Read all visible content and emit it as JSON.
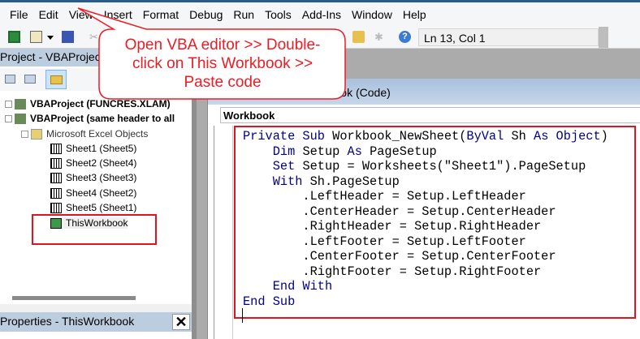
{
  "menu": [
    "File",
    "Edit",
    "View",
    "Insert",
    "Format",
    "Debug",
    "Run",
    "Tools",
    "Add-Ins",
    "Window",
    "Help"
  ],
  "toolbar": {
    "position": "Ln 13, Col 1"
  },
  "project": {
    "title": "Project - VBAProject",
    "tree": [
      "VBAProject (FUNCRES.XLAM)",
      "VBAProject (same header to all",
      "Microsoft Excel Objects",
      "Sheet1 (Sheet5)",
      "Sheet2 (Sheet4)",
      "Sheet3 (Sheet3)",
      "Sheet4 (Sheet2)",
      "Sheet5 (Sheet1)",
      "ThisWorkbook"
    ]
  },
  "properties": {
    "title": "Properties - ThisWorkbook",
    "close": "✕"
  },
  "codewindow": {
    "title": "ets.xlsx - ThisWorkbook (Code)",
    "object": "Workbook"
  },
  "code": [
    [
      [
        "kw",
        "Private Sub "
      ],
      [
        "",
        "Workbook_NewSheet("
      ],
      [
        "kw",
        "ByVal "
      ],
      [
        "",
        "Sh "
      ],
      [
        "kw",
        "As Object"
      ],
      [
        "",
        ")"
      ]
    ],
    [
      [
        "",
        "    "
      ],
      [
        "kw",
        "Dim "
      ],
      [
        "",
        "Setup "
      ],
      [
        "kw",
        "As "
      ],
      [
        "",
        "PageSetup"
      ]
    ],
    [
      [
        "",
        "    "
      ],
      [
        "kw",
        "Set "
      ],
      [
        "",
        "Setup = Worksheets(\"Sheet1\").PageSetup"
      ]
    ],
    [
      [
        "",
        "    "
      ],
      [
        "kw",
        "With "
      ],
      [
        "",
        "Sh.PageSetup"
      ]
    ],
    [
      [
        "",
        "        .LeftHeader = Setup.LeftHeader"
      ]
    ],
    [
      [
        "",
        "        .CenterHeader = Setup.CenterHeader"
      ]
    ],
    [
      [
        "",
        "        .RightHeader = Setup.RightHeader"
      ]
    ],
    [
      [
        "",
        "        .LeftFooter = Setup.LeftFooter"
      ]
    ],
    [
      [
        "",
        "        .CenterFooter = Setup.CenterFooter"
      ]
    ],
    [
      [
        "",
        "        .RightFooter = Setup.RightFooter"
      ]
    ],
    [
      [
        "",
        "    "
      ],
      [
        "kw",
        "End With"
      ]
    ],
    [
      [
        "kw",
        "End Sub"
      ]
    ]
  ],
  "callout": {
    "lines": [
      "Open VBA editor >> Double-",
      "click on This Workbook >>",
      "Paste code"
    ],
    "color": "#ee1c24"
  }
}
